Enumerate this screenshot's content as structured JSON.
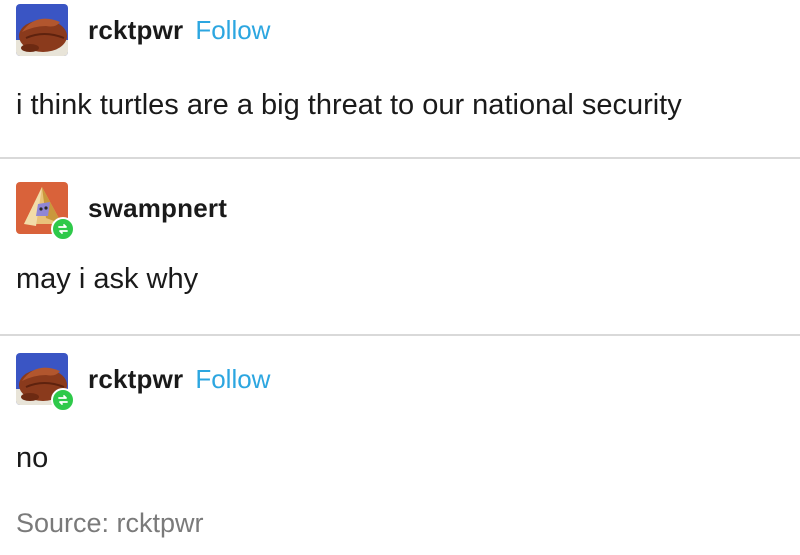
{
  "posts": [
    {
      "username": "rcktpwr",
      "follow_label": "Follow",
      "text": "i think turtles are a big threat to our national security",
      "reblog": false
    },
    {
      "username": "swampnert",
      "follow_label": "",
      "text": "may i ask why",
      "reblog": true
    },
    {
      "username": "rcktpwr",
      "follow_label": "Follow",
      "text": "no",
      "reblog": true
    }
  ],
  "source": {
    "text": "Source: rcktpwr"
  },
  "colors": {
    "follow": "#2ca6e0",
    "reblog_badge": "#2ec94a",
    "divider": "#d9d9d9",
    "source_text": "#7a7a7a"
  },
  "icons": {
    "avatar_1": "turtle-avatar-icon",
    "avatar_2": "pyramid-avatar-icon",
    "avatar_3": "turtle-avatar-icon",
    "reblog_badge": "reblog-icon"
  }
}
